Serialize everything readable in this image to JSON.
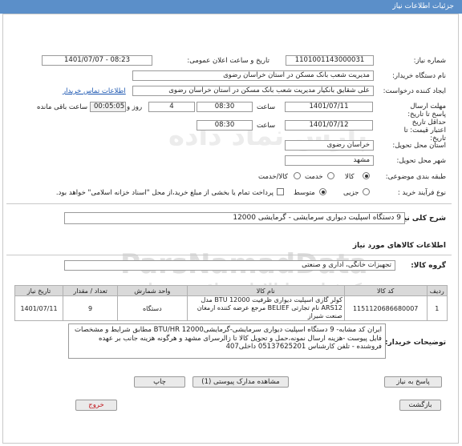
{
  "header": {
    "title": "جزئیات اطلاعات نیاز"
  },
  "need_number": {
    "label": "شماره نیاز:",
    "value": "1101001143000031"
  },
  "announce": {
    "label": "تاریخ و ساعت اعلان عمومی:",
    "value": "1401/07/07 - 08:23"
  },
  "buyer_org": {
    "label": "نام دستگاه خریدار:",
    "value": "مدیریت شعب بانک مسکن در استان خراسان رضوی"
  },
  "requester": {
    "label": "ایجاد کننده درخواست:",
    "value": "علی شقایق بانکیار مدیریت شعب بانک مسکن در استان خراسان رضوی",
    "contact_link": "اطلاعات تماس خریدار"
  },
  "deadline": {
    "label": "مهلت ارسال پاسخ تا تاریخ:",
    "date": "1401/07/11",
    "time_label": "ساعت",
    "time": "08:30",
    "days": "4",
    "days_label": "روز و",
    "remaining": "00:05:05",
    "remaining_label": "ساعت باقی مانده"
  },
  "validity": {
    "label": "حداقل تاریخ اعتبار قیمت: تا تاریخ:",
    "date": "1401/07/12",
    "time_label": "ساعت",
    "time": "08:30"
  },
  "province": {
    "label": "استان محل تحویل:",
    "value": "خراسان رضوی"
  },
  "city": {
    "label": "شهر محل تحویل:",
    "value": "مشهد"
  },
  "category": {
    "label": "طبقه بندی موضوعی:",
    "options": [
      "کالا",
      "خدمت",
      "کالا/خدمت"
    ],
    "selected": "کالا"
  },
  "purchase": {
    "label": "نوع فرآیند خرید :",
    "options": [
      "جزیی",
      "متوسط"
    ],
    "selected": "متوسط",
    "payment_note": "پرداخت تمام یا بخشی از مبلغ خرید،از محل \"اسناد خزانه اسلامی\" خواهد بود."
  },
  "summary": {
    "label": "شرح کلی نیاز:",
    "value": "9 دستگاه اسپلیت دیواری سرمایشی - گرمایشی 12000"
  },
  "goods_info": {
    "title": "اطلاعات کالاهای مورد نیاز"
  },
  "goods_group": {
    "label": "گروه کالا:",
    "value": "تجهیزات خانگی، اداری و صنعتی"
  },
  "table": {
    "headers": [
      "ردیف",
      "کد کالا",
      "نام کالا",
      "واحد شمارش",
      "تعداد / مقدار",
      "تاریخ نیاز"
    ],
    "rows": [
      {
        "row": "1",
        "code": "1151120686680007",
        "name": "کولر گازی اسپلیت دیواری ظرفیت 12000 BTU مدل ARS12 نام تجارتی BELIEF مرجع عرضه کننده ارمغان صنعت شیراز",
        "unit": "دستگاه",
        "qty": "9",
        "date": "1401/07/11"
      }
    ]
  },
  "buyer_notes": {
    "label": "توضیحات خریدار:",
    "value": "ایران کد مشابه- 9 دستگاه اسپلیت دیواری سرمایشی-گرمایشی12000 BTU/HR مطابق شرایط و مشخصات فایل پیوست -هزینه ارسال نمونه،حمل و تحویل کالا تا زالرسرای مشهد و هرگونه هزینه جانب بر عهده فروشنده - تلفن کارشناس 05137625201 داخلی407"
  },
  "buttons": {
    "reply": "پاسخ به نیاز",
    "attachments": "مشاهده مدارک پیوستی (1)",
    "print": "چاپ",
    "back": "بازگشت",
    "exit": "خروج"
  },
  "watermark": {
    "text": "ParsNamadData",
    "fa": "پارس نماد داده",
    "sub": "مرکز فراوری اطلاعات مناقصه و مزایده"
  }
}
